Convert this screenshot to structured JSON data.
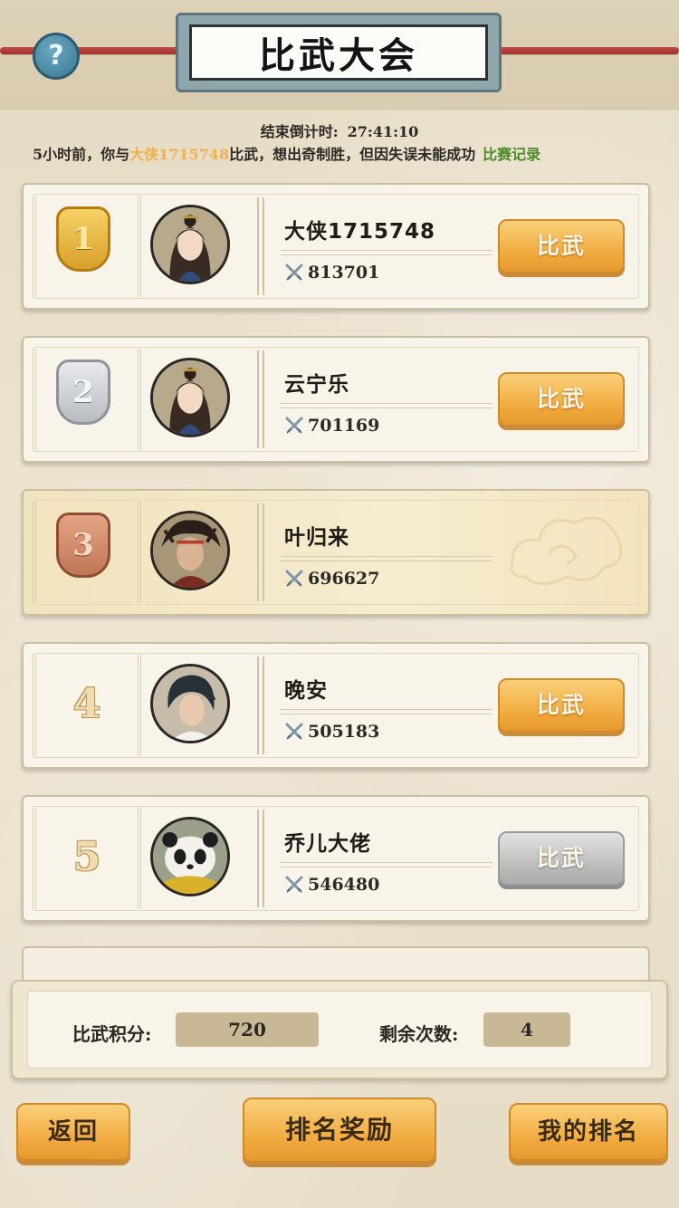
{
  "header": {
    "title": "比武大会",
    "help_icon": "?"
  },
  "countdown": {
    "label": "结束倒计时:",
    "time": "27:41:10"
  },
  "notice": {
    "prefix": "5小时前，你与",
    "opponent": "大侠1715748",
    "suffix": "比武，想出奇制胜，但因失误未能成功",
    "record_link": "比赛记录"
  },
  "ranking": [
    {
      "rank": "1",
      "name": "大侠1715748",
      "power": "813701",
      "button": "比武",
      "button_state": "active",
      "badge": "gold"
    },
    {
      "rank": "2",
      "name": "云宁乐",
      "power": "701169",
      "button": "比武",
      "button_state": "active",
      "badge": "silver"
    },
    {
      "rank": "3",
      "name": "叶归来",
      "power": "696627",
      "button": "",
      "button_state": "self",
      "badge": "bronze"
    },
    {
      "rank": "4",
      "name": "晚安",
      "power": "505183",
      "button": "比武",
      "button_state": "active",
      "badge": "plain"
    },
    {
      "rank": "5",
      "name": "乔儿大佬",
      "power": "546480",
      "button": "比武",
      "button_state": "disabled",
      "badge": "plain"
    }
  ],
  "score_panel": {
    "points_label": "比武积分:",
    "points_value": "720",
    "remaining_label": "剩余次数:",
    "remaining_value": "4"
  },
  "bottom_bar": {
    "back": "返回",
    "rewards": "排名奖励",
    "my_rank": "我的排名"
  },
  "colors": {
    "button_orange": "#f0a73a",
    "button_disabled": "#b9b9b9",
    "highlight_name": "#f0b04a",
    "link_green": "#4b8a24"
  }
}
